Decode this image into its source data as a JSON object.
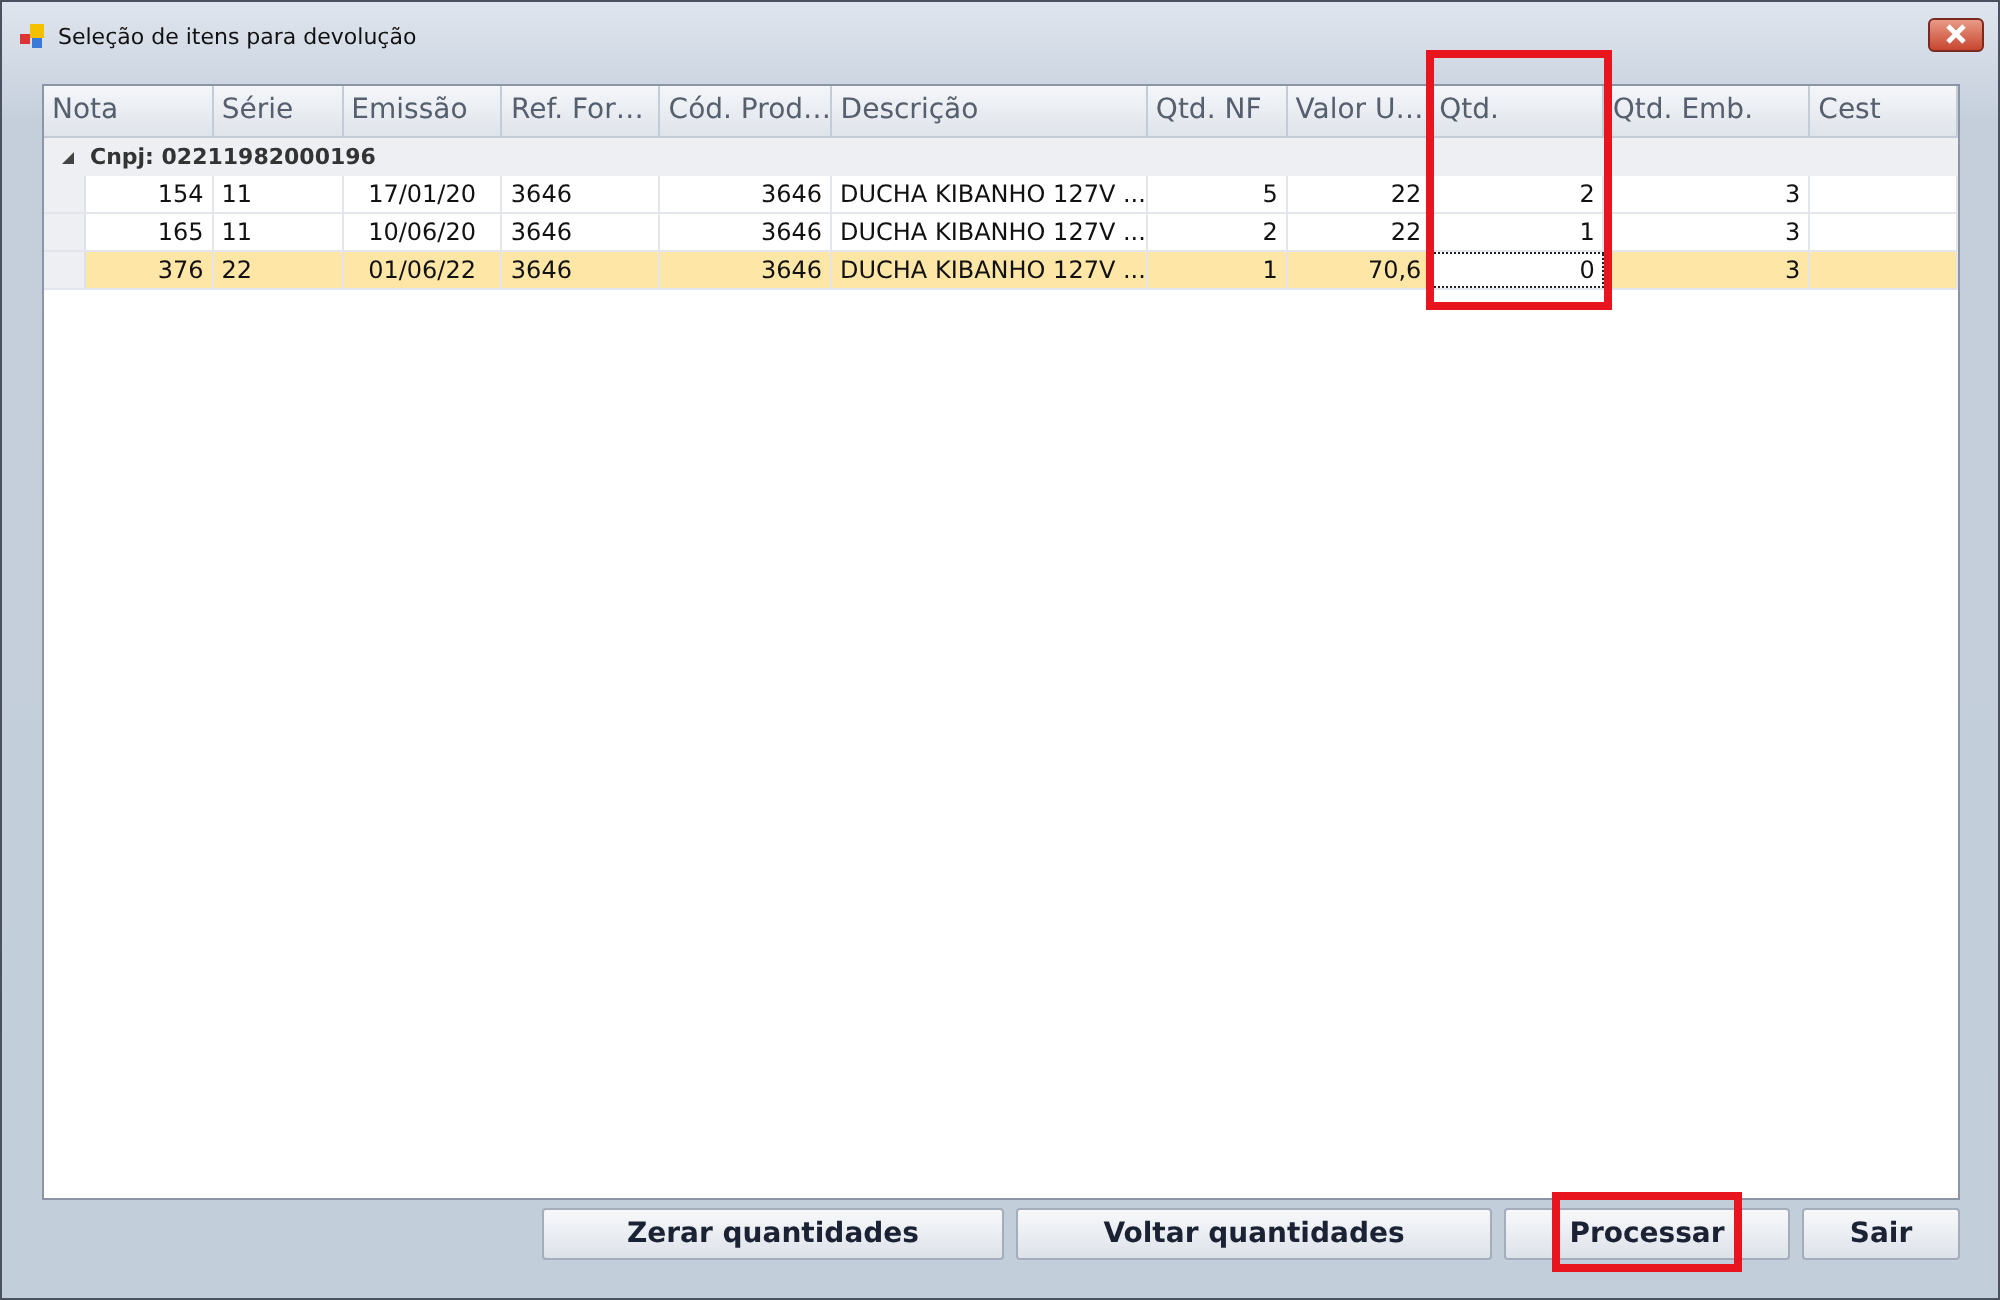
{
  "window": {
    "title": "Seleção de itens para devolução"
  },
  "table": {
    "columns": [
      {
        "label": "Nota",
        "kind": "number",
        "highlighted": false
      },
      {
        "label": "Série",
        "kind": "text",
        "highlighted": false
      },
      {
        "label": "Emissão",
        "kind": "date",
        "highlighted": false
      },
      {
        "label": "Ref. For…",
        "kind": "text",
        "highlighted": false
      },
      {
        "label": "Cód. Prod…",
        "kind": "number",
        "highlighted": false
      },
      {
        "label": "Descrição",
        "kind": "text",
        "highlighted": false
      },
      {
        "label": "Qtd. NF",
        "kind": "number",
        "highlighted": false
      },
      {
        "label": "Valor U…",
        "kind": "number",
        "highlighted": false
      },
      {
        "label": "Qtd.",
        "kind": "number",
        "highlighted": true,
        "editable": true
      },
      {
        "label": "Qtd. Emb.",
        "kind": "number",
        "highlighted": false
      },
      {
        "label": "Cest",
        "kind": "text",
        "highlighted": false
      }
    ],
    "group": {
      "label": "Cnpj: 02211982000196",
      "expanded": true
    },
    "rows": [
      {
        "selected": false,
        "cells": [
          "154",
          "11",
          "17/01/20",
          "3646",
          "3646",
          "DUCHA KIBANHO 127V ...",
          "5",
          "22",
          "2",
          "3",
          ""
        ]
      },
      {
        "selected": false,
        "cells": [
          "165",
          "11",
          "10/06/20",
          "3646",
          "3646",
          "DUCHA KIBANHO 127V ...",
          "2",
          "22",
          "1",
          "3",
          ""
        ]
      },
      {
        "selected": true,
        "cells": [
          "376",
          "22",
          "01/06/22",
          "3646",
          "3646",
          "DUCHA KIBANHO 127V ...",
          "1",
          "70,6",
          "0",
          "3",
          ""
        ]
      }
    ]
  },
  "buttons": [
    {
      "label": "Zerar quantidades",
      "highlighted": false
    },
    {
      "label": "Voltar quantidades",
      "highlighted": false
    },
    {
      "label": "Processar",
      "highlighted": true
    },
    {
      "label": "Sair",
      "highlighted": false
    }
  ]
}
